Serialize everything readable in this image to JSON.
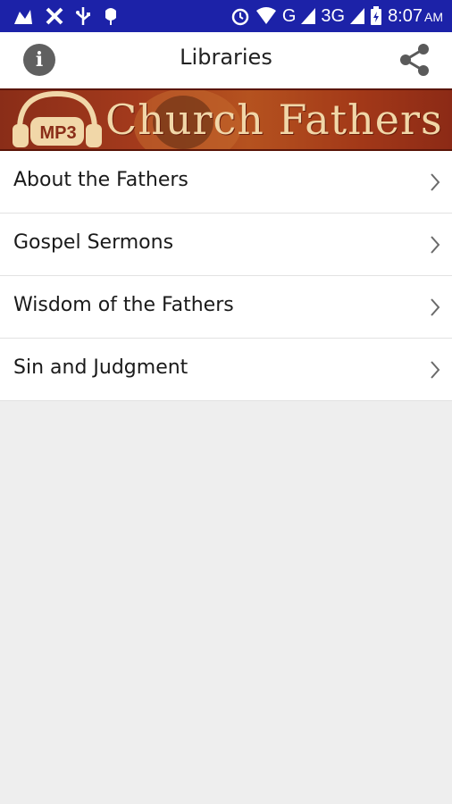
{
  "status_bar": {
    "network": "G",
    "network2": "3G",
    "time": "8:07",
    "ampm": "AM",
    "background": "#1c22a8",
    "left_icons": [
      "notification-icon",
      "missed-call-icon",
      "usb-icon",
      "android-debug-icon"
    ],
    "right_icons": [
      "alarm-icon",
      "wifi-icon",
      "signal-icon",
      "signal-icon",
      "battery-charging-icon"
    ]
  },
  "toolbar": {
    "title": "Libraries",
    "info_icon": "info-icon",
    "share_icon": "share-icon"
  },
  "banner": {
    "mp3_label": "MP3",
    "title": "Church Fathers",
    "colors": {
      "background": "#a33a1c",
      "text": "#f1d7a8"
    }
  },
  "libraries": [
    {
      "label": "About the Fathers"
    },
    {
      "label": "Gospel Sermons"
    },
    {
      "label": "Wisdom of the Fathers"
    },
    {
      "label": "Sin and Judgment"
    }
  ]
}
